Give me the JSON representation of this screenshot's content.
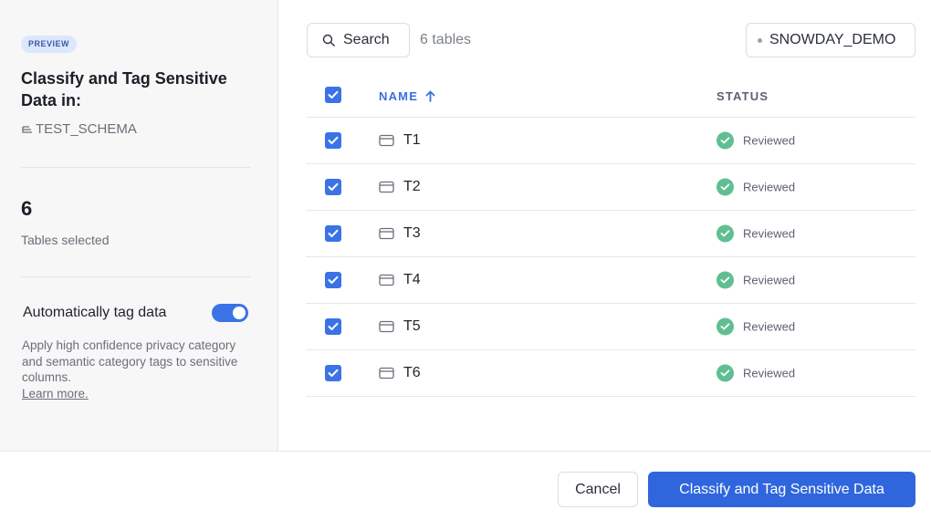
{
  "sidebar": {
    "badge": "PREVIEW",
    "title": "Classify and Tag Sensitive Data in:",
    "schema": "TEST_SCHEMA",
    "schema_icon": "schema-icon",
    "selected_count": "6",
    "selected_label": "Tables selected",
    "auto_tag_label": "Automatically tag data",
    "auto_tag_enabled": true,
    "help_text": "Apply high confidence privacy category and semantic category tags to sensitive columns.",
    "learn_more": "Learn more."
  },
  "toolbar": {
    "search_label": "Search",
    "search_icon": "search-icon",
    "tables_count": "6 tables",
    "database": "SNOWDAY_DEMO"
  },
  "table": {
    "columns": {
      "name": "NAME",
      "status": "STATUS"
    },
    "sort_icon": "arrow-up-icon",
    "rows": [
      {
        "name": "T1",
        "status": "Reviewed"
      },
      {
        "name": "T2",
        "status": "Reviewed"
      },
      {
        "name": "T3",
        "status": "Reviewed"
      },
      {
        "name": "T4",
        "status": "Reviewed"
      },
      {
        "name": "T5",
        "status": "Reviewed"
      },
      {
        "name": "T6",
        "status": "Reviewed"
      }
    ]
  },
  "footer": {
    "cancel_label": "Cancel",
    "primary_label": "Classify and Tag Sensitive Data"
  },
  "colors": {
    "accent": "#2f66de",
    "checkbox": "#3b73e6",
    "status_ok": "#5fbf93",
    "badge_bg": "#dde7fb"
  }
}
